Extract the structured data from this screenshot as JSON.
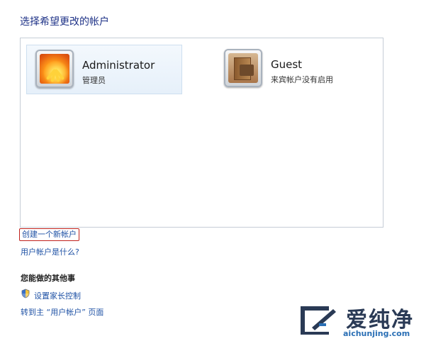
{
  "page": {
    "title": "选择希望更改的帐户"
  },
  "accounts": [
    {
      "name": "Administrator",
      "role": "管理员",
      "avatar": "orange-flower-avatar",
      "selected": true
    },
    {
      "name": "Guest",
      "role": "来宾帐户没有启用",
      "avatar": "suitcase-door-avatar",
      "selected": false
    }
  ],
  "links": {
    "create_account": "创建一个新帐户",
    "what_is_account": "用户帐户是什么?"
  },
  "other_tasks": {
    "heading": "您能做的其他事",
    "parental_controls": "设置家长控制",
    "parental_icon": "shield-icon",
    "go_to_main": "转到主 “用户帐户” 页面"
  },
  "watermark": {
    "brand": "爱纯净",
    "url": "aichunjing.com"
  },
  "colors": {
    "title": "#1e3287",
    "link": "#1f52a5",
    "highlight_border": "#c0211b",
    "selection_bg": "#e6f0fa"
  }
}
